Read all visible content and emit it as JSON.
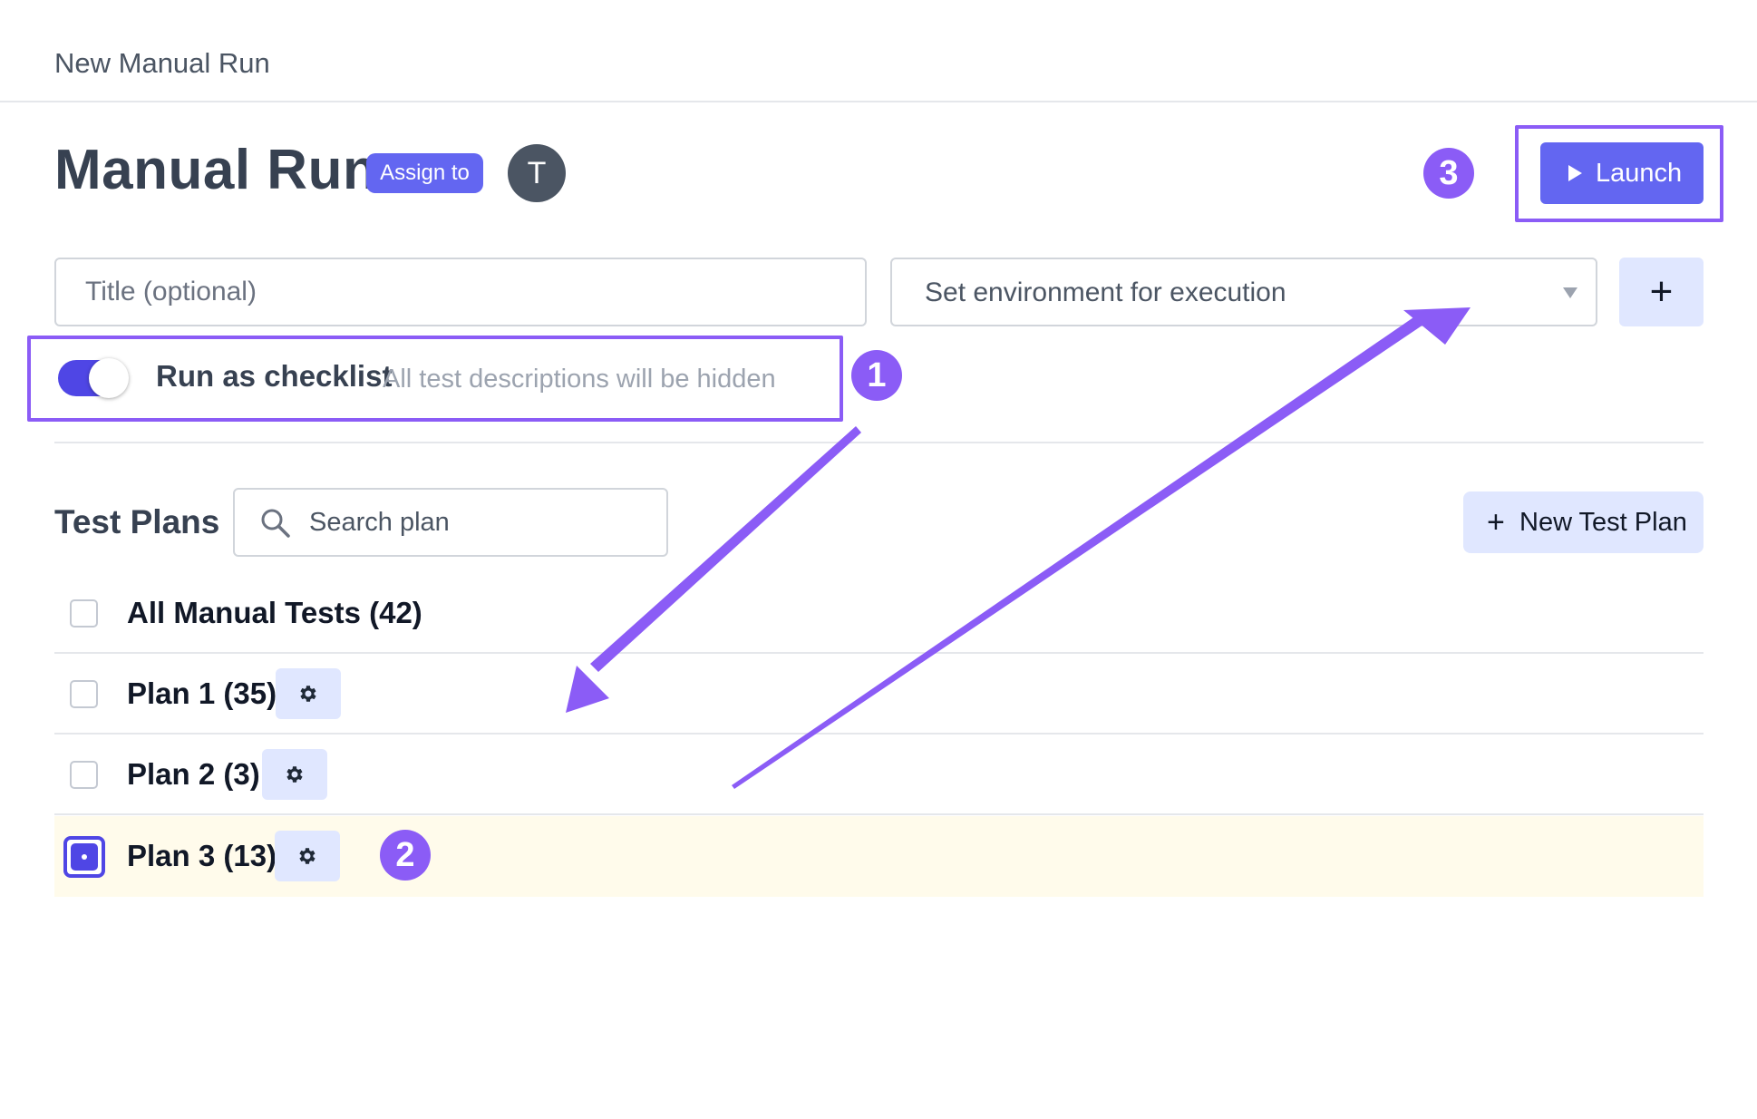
{
  "topbar": {
    "title": "New Manual Run"
  },
  "header": {
    "title": "Manual Run",
    "assign_label": "Assign to",
    "avatar_initial": "T",
    "launch_label": "Launch"
  },
  "form": {
    "title_placeholder": "Title (optional)",
    "environment_value": "Set environment for execution",
    "add_environment_symbol": "+"
  },
  "checklist": {
    "enabled": true,
    "label": "Run as checklist",
    "hint": "All test descriptions will be hidden"
  },
  "plans": {
    "section_title": "Test Plans",
    "search_placeholder": "Search plan",
    "new_plan_label": "New Test Plan",
    "new_plan_symbol": "+",
    "items": [
      {
        "label": "All Manual Tests (42)",
        "checked": false,
        "has_settings": false
      },
      {
        "label": "Plan 1 (35)",
        "checked": false,
        "has_settings": true
      },
      {
        "label": "Plan 2 (3)",
        "checked": false,
        "has_settings": true
      },
      {
        "label": "Plan 3 (13)",
        "checked": true,
        "has_settings": true
      }
    ]
  },
  "annotations": {
    "color": "#8b5cf6",
    "badges": [
      "1",
      "2",
      "3"
    ]
  },
  "colors": {
    "primary": "#6366f1",
    "primary_light": "#e0e7ff",
    "selected_row": "#fffbeb",
    "annotation": "#8b5cf6"
  }
}
